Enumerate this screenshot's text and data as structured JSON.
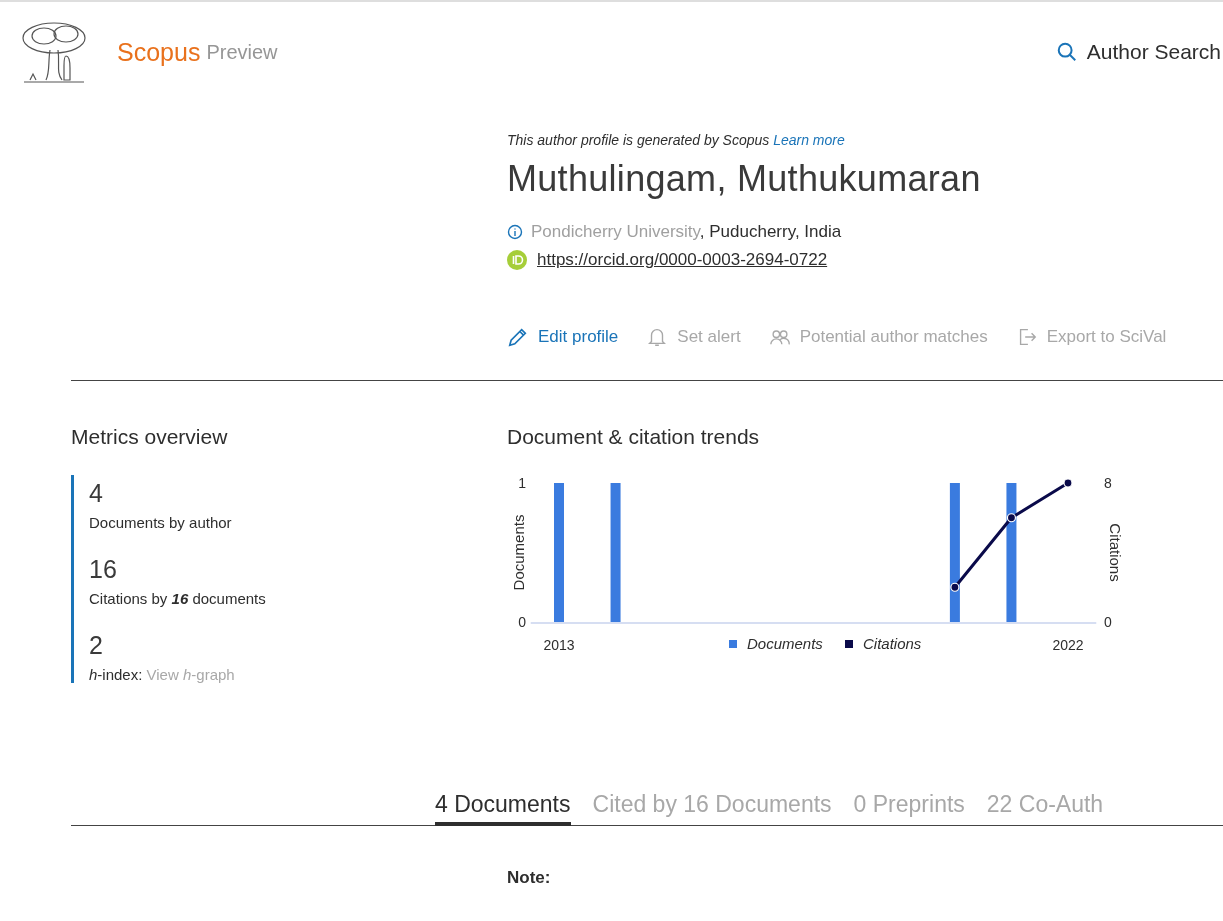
{
  "header": {
    "brand": "Scopus",
    "brand_suffix": "Preview",
    "search_link": "Author Search"
  },
  "profile": {
    "notice": "This author profile is generated by Scopus",
    "notice_link": "Learn more",
    "name": "Muthulingam, Muthukumaran",
    "affiliation": {
      "institution": "Pondicherry University",
      "location": ", Puducherry, India"
    },
    "orcid": "https://orcid.org/0000-0003-2694-0722",
    "actions": [
      {
        "kind": "edit",
        "label": "Edit profile",
        "disabled": false
      },
      {
        "kind": "alert",
        "label": "Set alert",
        "disabled": true
      },
      {
        "kind": "matches",
        "label": "Potential author matches",
        "disabled": true
      },
      {
        "kind": "export",
        "label": "Export to SciVal",
        "disabled": true
      }
    ]
  },
  "metrics": {
    "title": "Metrics overview",
    "items": [
      {
        "value": "4",
        "label": "Documents by author"
      },
      {
        "value": "16",
        "label": "Citations by **16** documents"
      },
      {
        "value": "2",
        "label": "*h*-index: ",
        "link": "View *h*-graph"
      }
    ]
  },
  "trends": {
    "title": "Document & citation trends",
    "chart_data": {
      "type": "bar",
      "ylabel": "Documents",
      "x": [
        2013,
        2014,
        2015,
        2016,
        2017,
        2018,
        2019,
        2020,
        2021,
        2022
      ],
      "xlim": [
        2012.5,
        2022.5
      ],
      "ylim": [
        0,
        1
      ],
      "yticks": [
        0,
        1
      ],
      "legend": "bottom",
      "series": [
        {
          "name": "Documents",
          "color": "#3a7bdf",
          "values": [
            1,
            1,
            0,
            0,
            0,
            0,
            0,
            1,
            1,
            0
          ]
        }
      ]
    },
    "citations_chart": {
      "chart_data": {
        "type": "line",
        "ylabel": "Citations",
        "x": [
          2020,
          2021,
          2022
        ],
        "xlim": [
          2012.5,
          2022.5
        ],
        "xticks": [
          2013,
          2022
        ],
        "ylim": [
          0,
          8
        ],
        "yticks": [
          0,
          8
        ],
        "series": [
          {
            "name": "Citations",
            "color": "#0a0a4a",
            "marker": true,
            "values": [
              2,
              6,
              8
            ]
          }
        ]
      }
    }
  },
  "tabs": [
    {
      "label": "4 Documents",
      "selected": true
    },
    {
      "label": "Cited by 16 Documents",
      "selected": false
    },
    {
      "label": "0 Preprints",
      "selected": false
    },
    {
      "label": "22 Co-Auth",
      "selected": false
    }
  ],
  "note": {
    "title": "Note:"
  }
}
